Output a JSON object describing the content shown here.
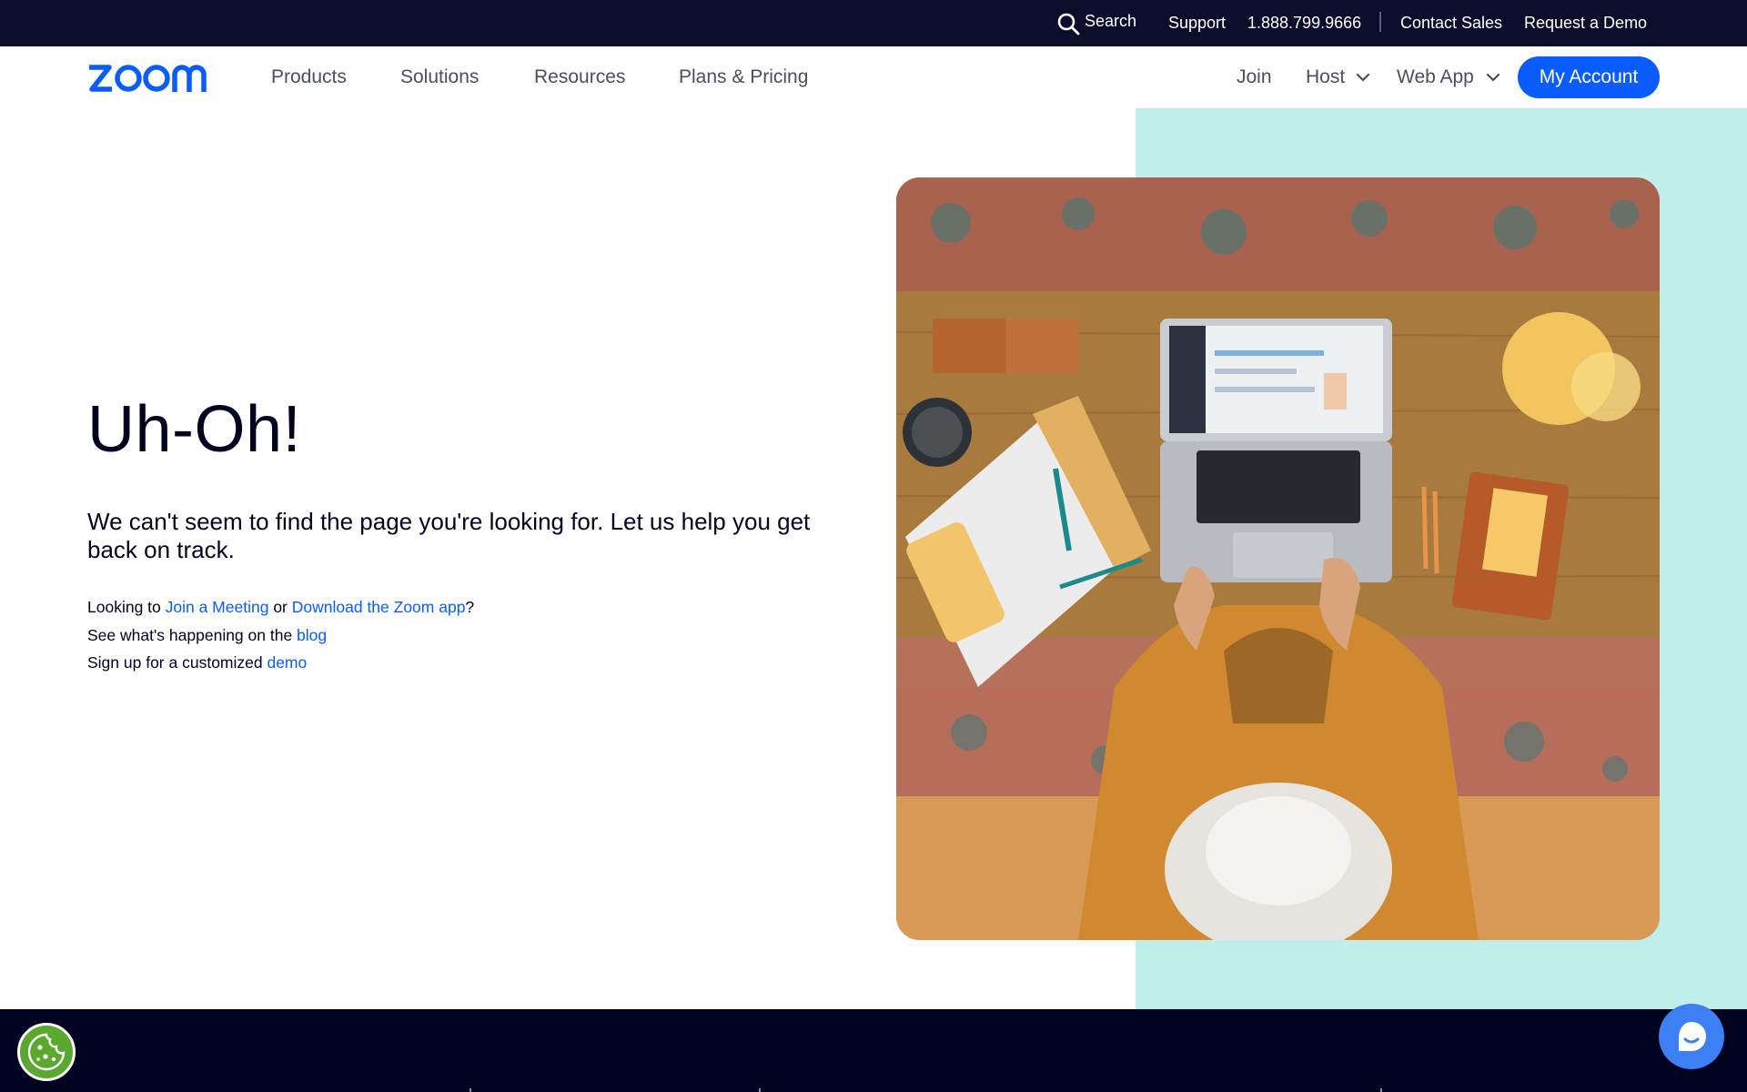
{
  "utility_bar": {
    "search_label": "Search",
    "support_label": "Support",
    "phone": "1.888.799.9666",
    "contact_sales_label": "Contact Sales",
    "request_demo_label": "Request a Demo"
  },
  "nav": {
    "logo_text": "zoom",
    "products_label": "Products",
    "solutions_label": "Solutions",
    "resources_label": "Resources",
    "plans_label": "Plans & Pricing",
    "join_label": "Join",
    "host_label": "Host",
    "webapp_label": "Web App",
    "account_label": "My Account"
  },
  "hero": {
    "title": "Uh-Oh!",
    "subtitle": "We can't seem to find the page you're looking for. Let us help you get back on track.",
    "line1_prefix": "Looking to ",
    "line1_link1": "Join a Meeting",
    "line1_mid": " or ",
    "line1_link2": "Download the Zoom app",
    "line1_suffix": "?",
    "line2_prefix": "See what's happening on the ",
    "line2_link": "blog",
    "line3_prefix": "Sign up for a customized ",
    "line3_link": "demo"
  },
  "colors": {
    "brand_blue": "#0b5cff",
    "dark_navy": "#00031f",
    "teal_panel": "#bfeeeb",
    "cookie_green": "#5aa82f"
  },
  "icons": {
    "search": "search-icon",
    "chevron": "chevron-down-icon",
    "cookie": "cookie-icon",
    "chat": "chat-bubble-icon"
  }
}
